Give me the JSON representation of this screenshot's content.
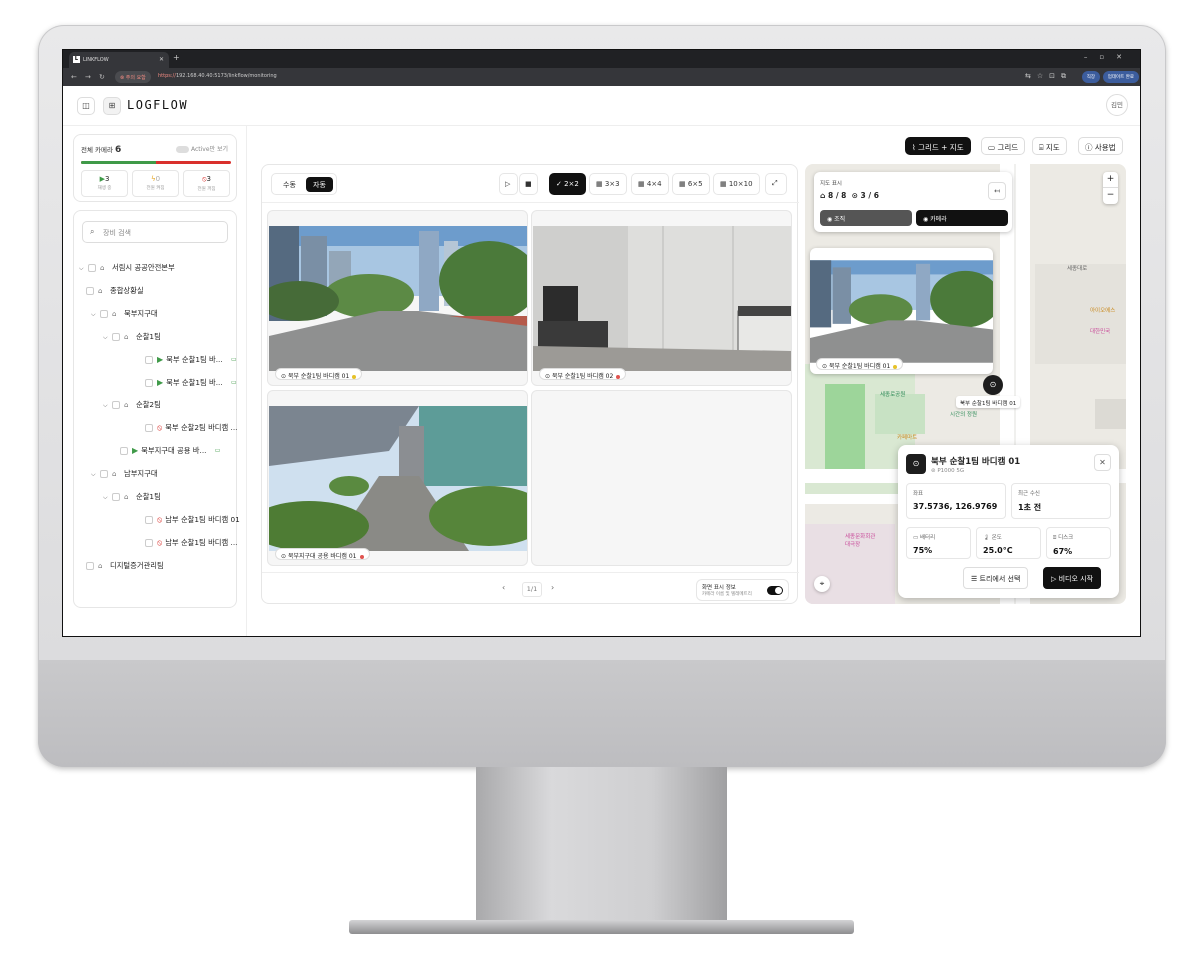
{
  "browser": {
    "tab_title": "LINKFLOW",
    "warning": "주의 요함",
    "url_scheme": "https://",
    "url_rest": "192.168.40.40:5173/linkflow/monitoring",
    "account": "직장",
    "update": "업데이트 완료"
  },
  "header": {
    "brand": "LOGFLOW",
    "user": "김민"
  },
  "stats": {
    "label": "전체 카메라",
    "total": "6",
    "toggle": "Active만 보기",
    "playing": "3",
    "playing_label": "재생 중",
    "charging": "0",
    "charging_label": "전원 켜짐",
    "off": "3",
    "off_label": "전원 꺼짐",
    "fraction_playing": 0.5
  },
  "search": {
    "placeholder": "장비 검색"
  },
  "tree": [
    {
      "label": "서림시 공공안전본부",
      "kind": "org"
    },
    {
      "label": "종합상황실",
      "kind": "org"
    },
    {
      "label": "북부지구대",
      "kind": "org"
    },
    {
      "label": "순찰1팀",
      "kind": "org"
    },
    {
      "label": "북부 순찰1팀 바...",
      "kind": "cam-on"
    },
    {
      "label": "북부 순찰1팀 바...",
      "kind": "cam-on"
    },
    {
      "label": "순찰2팀",
      "kind": "org"
    },
    {
      "label": "북부 순찰2팀 바디캠 ...",
      "kind": "cam-off"
    },
    {
      "label": "북부지구대 공용 바...",
      "kind": "cam-on"
    },
    {
      "label": "남부지구대",
      "kind": "org"
    },
    {
      "label": "순찰1팀",
      "kind": "org"
    },
    {
      "label": "남부 순찰1팀 바디캠 01",
      "kind": "cam-off"
    },
    {
      "label": "남부 순찰1팀 바디캠 ...",
      "kind": "cam-off"
    },
    {
      "label": "디지털증거관리팀",
      "kind": "org"
    }
  ],
  "topbar": {
    "grid_map": "그리드 + 지도",
    "grid": "그리드",
    "map": "지도",
    "help": "사용법"
  },
  "toolbar": {
    "manual": "수동",
    "auto": "자동",
    "layouts": [
      "2×2",
      "3×3",
      "4×4",
      "6×5",
      "10×10"
    ]
  },
  "tiles": [
    {
      "label": "북부 순찰1팀 바디캠 01",
      "dot": "#e6c229"
    },
    {
      "label": "북부 순찰1팀 바디캠 02",
      "dot": "#e0534f"
    },
    {
      "label": "북부지구대 공용 바디캠 01",
      "dot": "#e0534f"
    }
  ],
  "pager": {
    "page": "1/1",
    "display_title": "화면 표시 정보",
    "display_sub": "카메라 이름 및 텔레메트리"
  },
  "map": {
    "display_label": "지도 표시",
    "org_count": "8 / 8",
    "cam_count": "3 / 6",
    "org_btn": "조직",
    "cam_btn": "카메라",
    "preview_label": "북부 순찰1팀 바디캠 01",
    "marker_label": "북부 순찰1팀 바디캠 01",
    "pois": [
      "세종대로",
      "아이오에스",
      "대한민국",
      "세종로공원",
      "시간의 정원",
      "카페마트",
      "세종문화회관 대극장"
    ]
  },
  "card": {
    "name": "북부 순찰1팀 바디캠 01",
    "model": "P1000 5G",
    "coord_label": "좌표",
    "coord": "37.5736, 126.9769",
    "recv_label": "최근 수신",
    "recv": "1초 전",
    "batt_label": "배터리",
    "batt": "75%",
    "temp_label": "온도",
    "temp": "25.0°C",
    "disk_label": "디스크",
    "disk": "67%",
    "select": "트리에서 선택",
    "start": "비디오 시작"
  }
}
